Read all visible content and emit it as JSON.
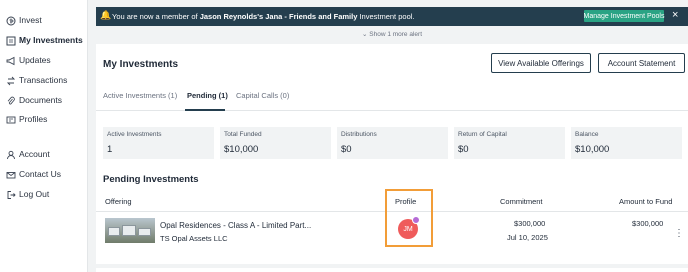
{
  "sidebar": {
    "items": [
      {
        "label": "Invest",
        "icon": "invest-icon"
      },
      {
        "label": "My Investments",
        "icon": "my-investments-icon",
        "active": true
      },
      {
        "label": "Updates",
        "icon": "megaphone-icon"
      },
      {
        "label": "Transactions",
        "icon": "transactions-icon"
      },
      {
        "label": "Documents",
        "icon": "paperclip-icon"
      },
      {
        "label": "Profiles",
        "icon": "profiles-icon"
      },
      {
        "label": "Account",
        "icon": "user-icon"
      },
      {
        "label": "Contact Us",
        "icon": "mail-icon"
      },
      {
        "label": "Log Out",
        "icon": "logout-icon"
      }
    ]
  },
  "banner": {
    "prefix": "You are now a member of ",
    "pool_name": "Jason Reynolds's Jana - Friends and Family",
    "suffix": " Investment pool.",
    "button_label": "Manage Investment Pools",
    "close": "×",
    "show_more": "⌄ Show 1 more alert"
  },
  "header": {
    "title": "My Investments",
    "view_offerings_label": "View Available Offerings",
    "account_statement_label": "Account Statement"
  },
  "tabs": [
    {
      "label": "Active Investments (1)"
    },
    {
      "label": "Pending (1)",
      "active": true
    },
    {
      "label": "Capital Calls (0)"
    }
  ],
  "stats": [
    {
      "label": "Active Investments",
      "value": "1"
    },
    {
      "label": "Total Funded",
      "value": "$10,000"
    },
    {
      "label": "Distributions",
      "value": "$0"
    },
    {
      "label": "Return of Capital",
      "value": "$0"
    },
    {
      "label": "Balance",
      "value": "$10,000"
    }
  ],
  "pending": {
    "title": "Pending Investments",
    "columns": {
      "offering": "Offering",
      "profile": "Profile",
      "commitment": "Commitment",
      "amount_to_fund": "Amount to Fund"
    },
    "rows": [
      {
        "name": "Opal Residences - Class A - Limited Part...",
        "issuer": "TS Opal Assets LLC",
        "profile_initials": "JM",
        "commitment": "$300,000",
        "date": "Jul 10, 2025",
        "amount_to_fund": "$300,000",
        "menu": "⋮"
      }
    ]
  },
  "colors": {
    "banner_bg": "#243e4e",
    "banner_button": "#2aa384",
    "avatar": "#ef5b5b",
    "highlight": "#f29d38"
  }
}
